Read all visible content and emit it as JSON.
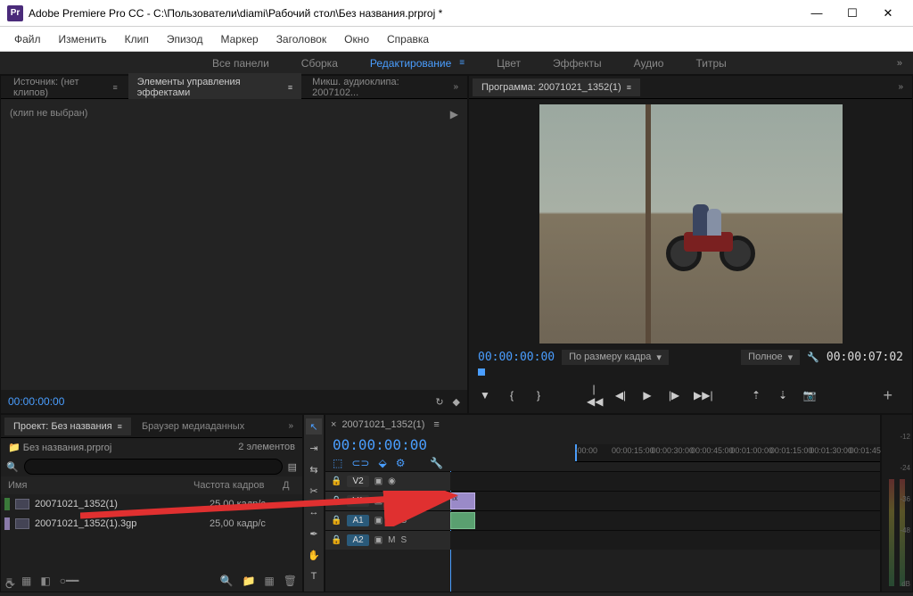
{
  "titlebar": {
    "app": "Pr",
    "title": "Adobe Premiere Pro CC - C:\\Пользователи\\diami\\Рабочий стол\\Без названия.prproj *"
  },
  "menu": [
    "Файл",
    "Изменить",
    "Клип",
    "Эпизод",
    "Маркер",
    "Заголовок",
    "Окно",
    "Справка"
  ],
  "workspaces": [
    {
      "label": "Все панели"
    },
    {
      "label": "Сборка"
    },
    {
      "label": "Редактирование",
      "active": true
    },
    {
      "label": "Цвет"
    },
    {
      "label": "Эффекты"
    },
    {
      "label": "Аудио"
    },
    {
      "label": "Титры"
    }
  ],
  "sourcetabs": [
    {
      "label": "Источник: (нет клипов)"
    },
    {
      "label": "Элементы управления эффектами",
      "active": true
    },
    {
      "label": "Микш. аудиоклипа: 2007102..."
    }
  ],
  "source": {
    "noclip": "(клип не выбран)",
    "tc": "00:00:00:00"
  },
  "program": {
    "tab": "Программа: 20071021_1352(1)",
    "tc_in": "00:00:00:00",
    "tc_out": "00:00:07:02",
    "fit": "По размеру кадра",
    "quality": "Полное"
  },
  "project": {
    "tab1": "Проект: Без названия",
    "tab2": "Браузер медиаданных",
    "path": "Без названия.prproj",
    "count": "2 элементов",
    "cols": {
      "name": "Имя",
      "fps": "Частота кадров",
      "du": "Д"
    },
    "rows": [
      {
        "name": "20071021_1352(1)",
        "fps": "25,00 кадр/с",
        "sw": "g"
      },
      {
        "name": "20071021_1352(1).3gp",
        "fps": "25,00 кадр/с",
        "sw": "p"
      }
    ]
  },
  "timeline": {
    "tab": "20071021_1352(1)",
    "tc": "00:00:00:00",
    "ruler": [
      ":00:00",
      "00:00:15:00",
      "00:00:30:00",
      "00:00:45:00",
      "00:01:00:00",
      "00:01:15:00",
      "00:01:30:00",
      "00:01:45"
    ],
    "tracks": {
      "v2": "V2",
      "v1": "V1",
      "a1": "A1",
      "a2": "A2"
    },
    "chanM": "M",
    "chanS": "S",
    "eye": "◉"
  },
  "audiometer": {
    "levels": [
      "-12",
      "-24",
      "-36",
      "-48",
      "dB"
    ]
  },
  "icons": {
    "search": "🔍",
    "gear": "⚙",
    "folder": "📁",
    "trash": "🗑",
    "new": "▦",
    "play": "▶",
    "stepb": "◀|",
    "stepf": "|▶",
    "goin": "|◀◀",
    "goout": "▶▶|",
    "mark_in": "{",
    "mark_out": "}",
    "dropdown": "▾",
    "chevrons": "»",
    "close": "×",
    "plus": "+",
    "camera": "📷",
    "export": "⤴",
    "lift": "⇡",
    "extract": "⇣",
    "lock": "🔒",
    "eye": "👁"
  }
}
